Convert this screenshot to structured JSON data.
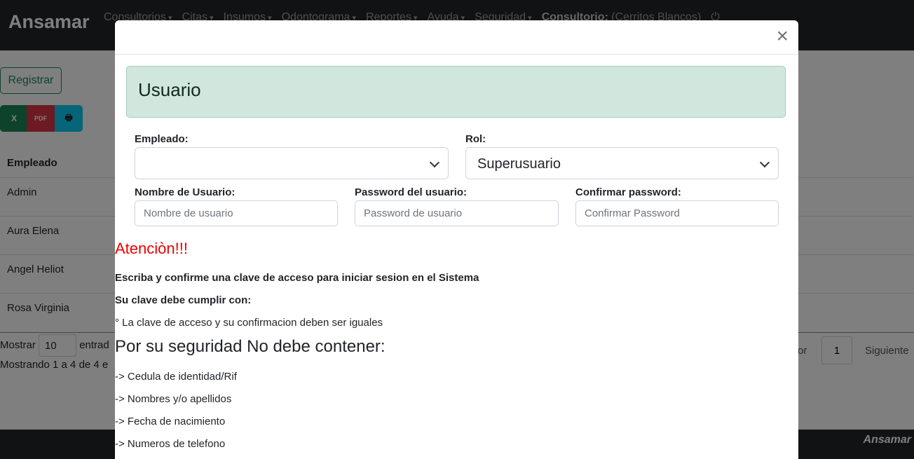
{
  "navbar": {
    "brand": "Ansamar",
    "menu": [
      "Consultorios",
      "Citas",
      "Insumos",
      "Odontograma",
      "Reportes",
      "Ayuda",
      "Seguridad"
    ],
    "consultorio_label": "Consultorio:",
    "consultorio_value": "(Cerritos Blancos)"
  },
  "page": {
    "register_button": "Registrar",
    "export": {
      "excel": "X",
      "pdf": "PDF"
    },
    "table": {
      "header": "Empleado",
      "rows": [
        "Admin",
        "Aura Elena",
        "Angel Heliot",
        "Rosa Virginia"
      ]
    },
    "show_label": "Mostrar",
    "show_value": "10",
    "show_suffix": "entrad",
    "info_text": "Mostrando 1 a 4 de 4 e",
    "pagination": {
      "prev": "or",
      "page": "1",
      "next": "Siguiente"
    }
  },
  "footer": {
    "brand": "Ansamar"
  },
  "modal": {
    "close": "×",
    "title": "Usuario",
    "empleado_label": "Empleado:",
    "empleado_value": "",
    "rol_label": "Rol:",
    "rol_value": "Superusuario",
    "username_label": "Nombre de Usuario:",
    "username_placeholder": "Nombre de usuario",
    "password_label": "Password del usuario:",
    "password_placeholder": "Password de usuario",
    "confirm_label": "Confirmar password:",
    "confirm_placeholder": "Confirmar Password",
    "atencion": "Atenciòn!!!",
    "line1": "Escriba y confirme una clave de acceso para iniciar sesion en el Sistema",
    "line2": "Su clave debe cumplir con:",
    "line3": "° La clave de acceso y su confirmacion deben ser iguales",
    "heading": "Por su seguridad No debe contener:",
    "items": [
      "-> Cedula de identidad/Rif",
      "-> Nombres y/o apellidos",
      "-> Fecha de nacimiento",
      "-> Numeros de telefono"
    ]
  }
}
